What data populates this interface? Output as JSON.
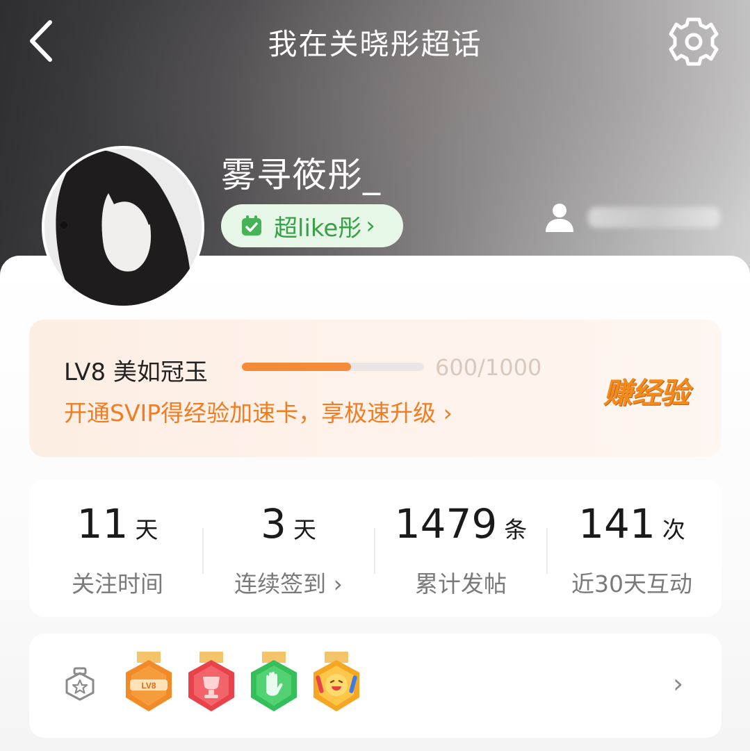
{
  "header": {
    "title": "我在关晓彤超话",
    "back_icon": "chevron-left-icon",
    "settings_icon": "gear-icon"
  },
  "profile": {
    "username": "雾寻筱彤_",
    "super_like_label": "超like彤",
    "super_like_chevron": "›",
    "user_icon": "person-icon"
  },
  "level": {
    "name": "LV8 美如冠玉",
    "progress_current": 600,
    "progress_total": 1000,
    "progress_text": "600/1000",
    "promo": "开通SVIP得经验加速卡，享极速升级 ›",
    "earn_label": "赚经验",
    "accent_color": "#f07d22"
  },
  "stats": [
    {
      "value": "11",
      "unit": "天",
      "label": "关注时间"
    },
    {
      "value": "3",
      "unit": "天",
      "label": "连续签到 ›"
    },
    {
      "value": "1479",
      "unit": "条",
      "label": "累计发帖"
    },
    {
      "value": "141",
      "unit": "次",
      "label": "近30天互动"
    }
  ],
  "badges": {
    "wall_icon": "badge-wall-icon",
    "items": [
      {
        "name": "lv-badge",
        "text": "LV8",
        "color": "#f07d22"
      },
      {
        "name": "trophy-badge",
        "text": "",
        "color": "#ec4a4a"
      },
      {
        "name": "hand-badge",
        "text": "",
        "color": "#3ec35a"
      },
      {
        "name": "cheer-badge",
        "text": "",
        "color": "#f5a623"
      }
    ],
    "chevron": "›"
  }
}
